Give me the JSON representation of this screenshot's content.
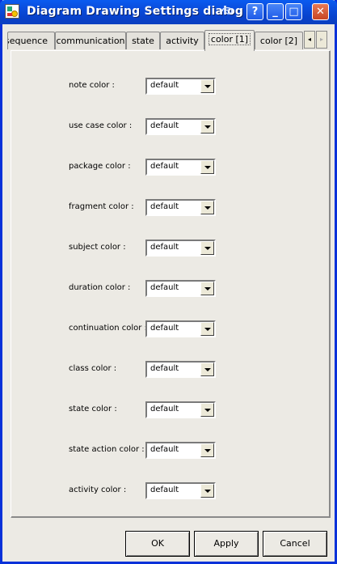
{
  "window": {
    "title": "Diagram Drawing Settings dialog"
  },
  "titlebar_buttons": {
    "help": "?",
    "minimize": "_",
    "maximize": "□",
    "close": "✕"
  },
  "tabs": [
    {
      "label": "sequence",
      "active": false
    },
    {
      "label": "communication",
      "active": false
    },
    {
      "label": "state",
      "active": false
    },
    {
      "label": "activity",
      "active": false
    },
    {
      "label": "color [1]",
      "active": true
    },
    {
      "label": "color [2]",
      "active": false
    }
  ],
  "tab_scroll": {
    "left": "◂",
    "right": "▸"
  },
  "color_settings": [
    {
      "label": "note color :",
      "value": "default"
    },
    {
      "label": "use case color :",
      "value": "default"
    },
    {
      "label": "package color :",
      "value": "default"
    },
    {
      "label": "fragment color :",
      "value": "default"
    },
    {
      "label": "subject color :",
      "value": "default"
    },
    {
      "label": "duration color :",
      "value": "default"
    },
    {
      "label": "continuation color :",
      "value": "default"
    },
    {
      "label": "class color :",
      "value": "default"
    },
    {
      "label": "state color :",
      "value": "default"
    },
    {
      "label": "state action color :",
      "value": "default"
    },
    {
      "label": "activity color :",
      "value": "default"
    }
  ],
  "buttons": {
    "ok": "OK",
    "apply": "Apply",
    "cancel": "Cancel"
  }
}
